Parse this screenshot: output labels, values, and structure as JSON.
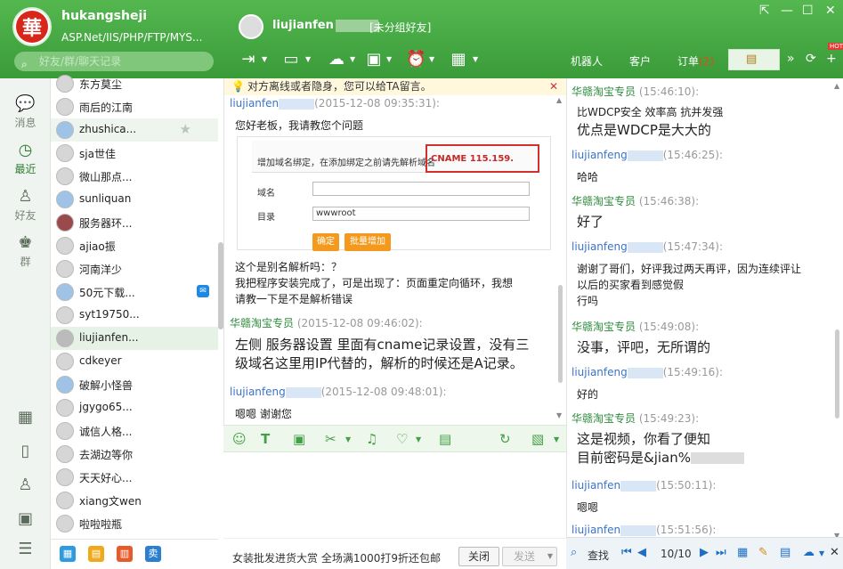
{
  "user": {
    "logo_char": "華",
    "name": "hukangsheji",
    "signature": "ASP.Net/IIS/PHP/FTP/MYS...",
    "search_placeholder": "好友/群/聊天记录"
  },
  "peer": {
    "name": "liujianfen",
    "group": "[未分组好友]"
  },
  "right_tabs": [
    {
      "label": "机器人"
    },
    {
      "label": "客户"
    },
    {
      "label": "订单",
      "badge": "(2)"
    }
  ],
  "hot_label": "HOT",
  "nav": [
    {
      "label": "消息"
    },
    {
      "label": "最近"
    },
    {
      "label": "好友"
    },
    {
      "label": "群"
    }
  ],
  "contacts": [
    "东方莫尘",
    "雨后的江南",
    "zhushica...",
    "sja世佳",
    "微山那点...",
    "sunliquan",
    "服务器环...",
    "ajiao振",
    "河南洋少",
    "50元下载...",
    "syt19750...",
    "liujianfen...",
    "cdkeyer",
    "破解小怪兽",
    "jgygo65...",
    "诚信人格...",
    "去湖边等你",
    "天天好心...",
    "xiang文wen",
    "啦啦啦瓶"
  ],
  "notice": "对方离线或者隐身，您可以给TA留言。",
  "messages": [
    {
      "sender": "liujianfen",
      "time": "(2015-12-08 09:35:31):",
      "text": "您好老板，我请教您个问题"
    },
    {
      "text_lines": [
        "这个是别名解析吗：？",
        "我把程序安装完成了，可是出现了：页面重定向循环，我想",
        "请教一下是不是解析错误"
      ]
    },
    {
      "sender": "华赣淘宝专员",
      "time": "(2015-12-08 09:46:02):",
      "text_lines": [
        "左侧 服务器设置 里面有cname记录设置，没有三",
        "级域名这里用IP代替的，解析的时候还是A记录。"
      ]
    },
    {
      "sender": "liujianfeng",
      "time": "(2015-12-08 09:48:01):",
      "text": "嗯嗯 谢谢您"
    }
  ],
  "shot": {
    "title": "增加域名绑定，在添加绑定之前请先解析域名",
    "cname": "CNAME 115.159.",
    "field1": "域名",
    "field2": "目录",
    "field2_value": "wwwroot",
    "btn_ok": "确定",
    "btn_batch": "批量增加"
  },
  "sendbar": {
    "ad": "女装批发进货大赏  全场满1000打9折还包邮",
    "close": "关闭",
    "send": "发送"
  },
  "history": [
    {
      "sender": "华赣淘宝专员",
      "time": "(15:46:10):",
      "lines": [
        "比WDCP安全 效率高 抗并发强"
      ],
      "big": [
        "优点是WDCP是大大的"
      ]
    },
    {
      "sender": "liujianfeng",
      "time": "(15:46:25):",
      "lines": [
        "哈哈"
      ]
    },
    {
      "sender": "华赣淘宝专员",
      "time": "(15:46:38):",
      "big": [
        "好了"
      ]
    },
    {
      "sender": "liujianfeng",
      "time": "(15:47:34):",
      "lines": [
        "谢谢了哥们，好评我过两天再评，因为连续评让",
        "以后的买家看到感觉假",
        "行吗"
      ]
    },
    {
      "sender": "华赣淘宝专员",
      "time": "(15:49:08):",
      "big": [
        "没事，评吧，无所谓的"
      ]
    },
    {
      "sender": "liujianfeng",
      "time": "(15:49:16):",
      "lines": [
        "好的"
      ]
    },
    {
      "sender": "华赣淘宝专员",
      "time": "(15:49:23):",
      "big": [
        "这是视频，你看了便知",
        "目前密码是&jian%"
      ]
    },
    {
      "sender": "liujianfen",
      "time": "(15:50:11):",
      "lines": [
        "嗯嗯"
      ]
    },
    {
      "sender": "liujianfen",
      "time": "(15:51:56):"
    }
  ],
  "histbar": {
    "find": "查找",
    "page": "10/10"
  }
}
